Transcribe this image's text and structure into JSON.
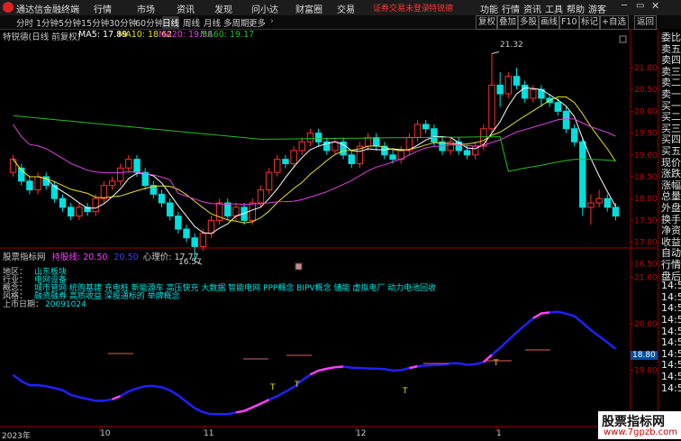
{
  "app": {
    "name": "通达信金融终端",
    "menus": [
      "行情",
      "市场",
      "资讯",
      "发现",
      "问小达",
      "财富圈",
      "交易"
    ],
    "warning": "证券交易未登录",
    "stock_link": "特锐德",
    "right_menus": [
      "功能",
      "行情",
      "资讯",
      "工具",
      "帮助",
      "游客"
    ]
  },
  "toolbar": {
    "periods": [
      "分时",
      "1分钟",
      "5分钟",
      "15分钟",
      "30分钟",
      "60分钟",
      "日线",
      "周线",
      "月线",
      "多周期",
      "更多"
    ],
    "active_period": "日线",
    "right_buttons": [
      "复权",
      "叠加",
      "多股",
      "画线",
      "F10",
      "标记",
      "+自选",
      "返回"
    ]
  },
  "main_chart": {
    "title": "特锐德(日线 前复权)",
    "ma": [
      {
        "label": "MA5: 17.89",
        "color": "#ffffff"
      },
      {
        "label": "MA10: 18.62",
        "color": "#e8e020"
      },
      {
        "label": "MA20: 19.58",
        "color": "#e040e0"
      },
      {
        "label": "MA60: 19.17",
        "color": "#20c020"
      }
    ],
    "high_label": "21.32",
    "low_label": "16.57",
    "price_axis": [
      "21.00",
      "20.50",
      "20.00",
      "19.50",
      "19.00",
      "18.50",
      "18.00",
      "17.50",
      "17.00",
      "16.50"
    ]
  },
  "indicator": {
    "title": "股票指标网",
    "line1": "持股线: 20.50",
    "line2": "20.50",
    "line3": "心理价: 17.77",
    "price_axis": [
      "21.00",
      "20.00",
      "19.00"
    ],
    "current_value": "18.80",
    "info": [
      {
        "k": "地区：",
        "v": "山东板块"
      },
      {
        "k": "行业：",
        "v": "电网设备"
      },
      {
        "k": "概念：",
        "v": "城市管网 统购基建 充电桩 新能源车 高压快充 大数据 智能电网 PPP概念 BIPV概念 储能 虚拟电厂 动力电池回收"
      },
      {
        "k": "风格：",
        "v": "融资融券 高质收益 深股通标的 举牌概念"
      },
      {
        "k": "上市日期：",
        "v": "20091024"
      }
    ],
    "t_marks": [
      "T",
      "T",
      "T",
      "T"
    ]
  },
  "date_axis": [
    "2023年",
    "10",
    "11",
    "12",
    "1"
  ],
  "right_panel": [
    "委比",
    "卖五",
    "卖四",
    "卖三",
    "卖二",
    "卖一",
    "买一",
    "买二",
    "买三",
    "买四",
    "买五",
    "现价",
    "涨跌",
    "涨幅",
    "总量",
    "外盘",
    "换手",
    "净资",
    "收益",
    "自动",
    "行情",
    "盘后",
    "14:50",
    "14:50",
    "14:50",
    "14:50",
    "14:50",
    "14:50",
    "14:50",
    "14:50",
    "14:50",
    "14:50"
  ],
  "watermark": {
    "title": "股票指标网",
    "url": "www.7gpzb.com"
  },
  "colors": {
    "up": "#ff3030",
    "down": "#00e0e0",
    "ma5": "#ffffff",
    "ma10": "#e8e020",
    "ma20": "#e040e0",
    "ma60": "#20c020",
    "axis": "#a00000",
    "indicator_blue": "#2020ff",
    "indicator_magenta": "#ff40ff"
  },
  "chart_data": {
    "type": "candlestick",
    "candles": [
      [
        18.6,
        18.9,
        18.5,
        19.0
      ],
      [
        18.7,
        18.4,
        18.3,
        18.8
      ],
      [
        18.4,
        18.2,
        18.1,
        18.5
      ],
      [
        18.2,
        18.5,
        18.1,
        18.6
      ],
      [
        18.5,
        18.3,
        18.2,
        18.6
      ],
      [
        18.3,
        18.0,
        17.9,
        18.4
      ],
      [
        18.0,
        17.8,
        17.7,
        18.1
      ],
      [
        17.8,
        17.6,
        17.5,
        17.9
      ],
      [
        17.6,
        17.8,
        17.5,
        17.9
      ],
      [
        17.8,
        17.7,
        17.6,
        17.9
      ],
      [
        17.7,
        18.0,
        17.6,
        18.1
      ],
      [
        18.0,
        18.3,
        17.9,
        18.4
      ],
      [
        18.3,
        18.4,
        18.2,
        18.5
      ],
      [
        18.4,
        18.7,
        18.3,
        18.8
      ],
      [
        18.7,
        18.9,
        18.6,
        19.0
      ],
      [
        18.9,
        18.6,
        18.5,
        19.0
      ],
      [
        18.6,
        18.3,
        18.2,
        18.7
      ],
      [
        18.3,
        18.1,
        18.0,
        18.4
      ],
      [
        18.1,
        17.9,
        17.8,
        18.2
      ],
      [
        17.9,
        17.6,
        17.5,
        18.0
      ],
      [
        17.6,
        17.3,
        17.2,
        17.7
      ],
      [
        17.3,
        17.1,
        17.0,
        17.4
      ],
      [
        17.1,
        16.9,
        16.57,
        17.2
      ],
      [
        16.9,
        17.2,
        16.8,
        17.3
      ],
      [
        17.2,
        17.5,
        17.1,
        17.6
      ],
      [
        17.5,
        17.9,
        17.4,
        18.0
      ],
      [
        17.9,
        17.6,
        17.5,
        18.0
      ],
      [
        17.6,
        17.8,
        17.5,
        17.9
      ],
      [
        17.8,
        17.5,
        17.4,
        17.9
      ],
      [
        17.5,
        17.9,
        17.4,
        18.0
      ],
      [
        17.9,
        18.2,
        17.8,
        18.3
      ],
      [
        18.2,
        18.6,
        18.1,
        18.7
      ],
      [
        18.6,
        18.9,
        18.5,
        19.0
      ],
      [
        18.9,
        18.8,
        18.7,
        19.0
      ],
      [
        18.8,
        19.1,
        18.7,
        19.2
      ],
      [
        19.1,
        19.3,
        19.0,
        19.4
      ],
      [
        19.3,
        19.5,
        19.2,
        19.6
      ],
      [
        19.5,
        19.3,
        19.2,
        19.6
      ],
      [
        19.3,
        19.1,
        19.0,
        19.4
      ],
      [
        19.1,
        19.3,
        19.0,
        19.4
      ],
      [
        19.3,
        19.0,
        18.9,
        19.4
      ],
      [
        19.0,
        18.8,
        18.7,
        19.1
      ],
      [
        18.8,
        19.2,
        18.7,
        19.3
      ],
      [
        19.2,
        19.4,
        19.1,
        19.5
      ],
      [
        19.4,
        19.2,
        19.1,
        19.5
      ],
      [
        19.2,
        19.0,
        18.9,
        19.3
      ],
      [
        19.0,
        18.9,
        18.8,
        19.1
      ],
      [
        18.9,
        19.1,
        18.8,
        19.2
      ],
      [
        19.1,
        19.4,
        19.0,
        19.5
      ],
      [
        19.4,
        19.7,
        19.3,
        19.8
      ],
      [
        19.7,
        19.6,
        19.5,
        19.8
      ],
      [
        19.6,
        19.3,
        19.2,
        19.7
      ],
      [
        19.3,
        19.1,
        19.0,
        19.4
      ],
      [
        19.1,
        19.3,
        19.0,
        19.4
      ],
      [
        19.3,
        19.1,
        19.0,
        19.4
      ],
      [
        19.1,
        19.0,
        18.9,
        19.2
      ],
      [
        19.0,
        19.2,
        18.9,
        19.3
      ],
      [
        19.2,
        19.6,
        19.1,
        19.7
      ],
      [
        19.6,
        20.6,
        19.5,
        21.32
      ],
      [
        20.6,
        20.4,
        20.1,
        20.9
      ],
      [
        20.4,
        20.8,
        20.3,
        20.9
      ],
      [
        20.8,
        20.6,
        20.5,
        21.0
      ],
      [
        20.6,
        20.3,
        20.2,
        20.7
      ],
      [
        20.3,
        20.5,
        20.2,
        20.6
      ],
      [
        20.5,
        20.3,
        20.1,
        20.6
      ],
      [
        20.3,
        20.2,
        20.1,
        20.4
      ],
      [
        20.2,
        20.0,
        19.9,
        20.3
      ],
      [
        20.0,
        19.6,
        19.5,
        20.1
      ],
      [
        19.6,
        19.3,
        19.2,
        19.7
      ],
      [
        19.3,
        17.8,
        17.6,
        19.4
      ],
      [
        17.8,
        17.9,
        17.4,
        18.1
      ],
      [
        17.9,
        18.0,
        17.8,
        18.2
      ],
      [
        18.0,
        17.8,
        17.7,
        18.1
      ],
      [
        17.8,
        17.6,
        17.5,
        17.9
      ]
    ]
  }
}
